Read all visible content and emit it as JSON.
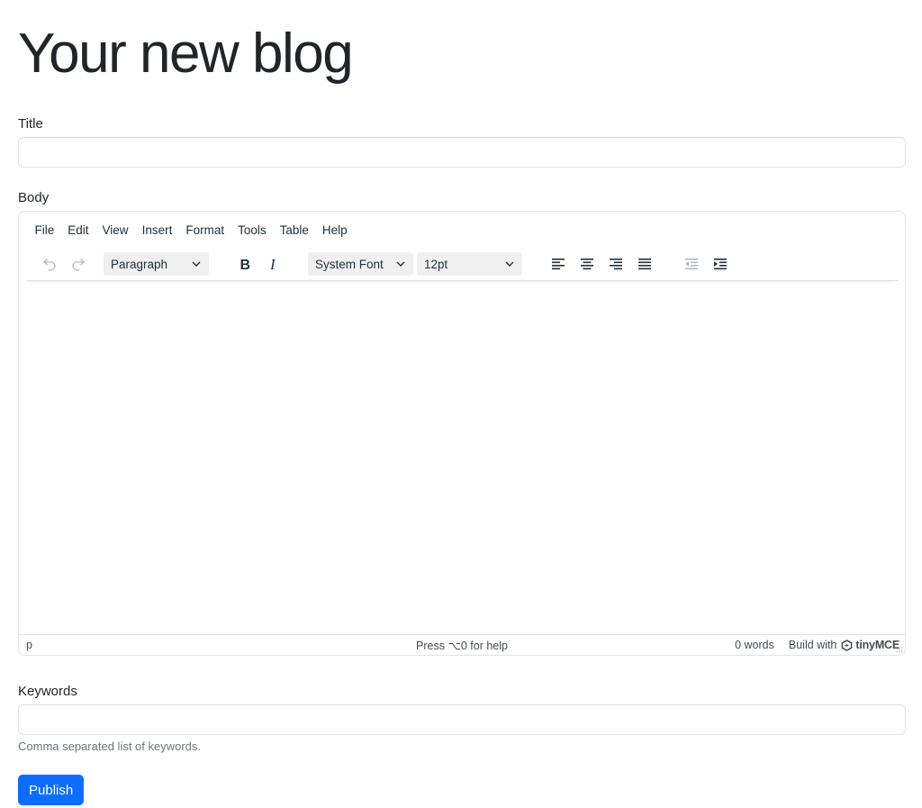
{
  "page": {
    "title": "Your new blog"
  },
  "title_field": {
    "label": "Title",
    "value": "",
    "placeholder": ""
  },
  "body_field": {
    "label": "Body"
  },
  "editor": {
    "menubar": [
      "File",
      "Edit",
      "View",
      "Insert",
      "Format",
      "Tools",
      "Table",
      "Help"
    ],
    "toolbar": {
      "block_format": "Paragraph",
      "font_family": "System Font",
      "font_size": "12pt"
    },
    "statusbar": {
      "path": "p",
      "help": "Press ⌥0 for help",
      "word_count": "0 words",
      "branding_prefix": "Build with",
      "branding_name": "tinyMCE"
    }
  },
  "keywords_field": {
    "label": "Keywords",
    "value": "",
    "placeholder": "",
    "help": "Comma separated list of keywords."
  },
  "actions": {
    "publish_label": "Publish"
  },
  "colors": {
    "primary": "#0d6efd",
    "text": "#212529",
    "border": "#dee2e6"
  }
}
